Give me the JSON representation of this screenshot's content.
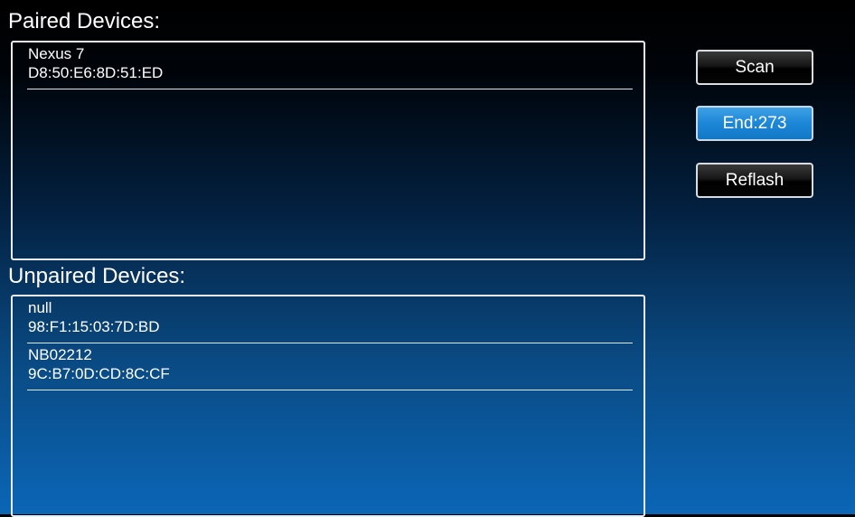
{
  "paired": {
    "title": "Paired Devices:",
    "devices": [
      {
        "name": "Nexus 7",
        "address": "D8:50:E6:8D:51:ED"
      }
    ]
  },
  "unpaired": {
    "title": "Unpaired Devices:",
    "devices": [
      {
        "name": "null",
        "address": "98:F1:15:03:7D:BD"
      },
      {
        "name": "NB02212",
        "address": "9C:B7:0D:CD:8C:CF"
      }
    ]
  },
  "buttons": {
    "scan": "Scan",
    "end": "End:273",
    "reflash": "Reflash"
  },
  "colors": {
    "accent_button": "#1c86d7",
    "background_top": "#000000",
    "background_bottom": "#0b66b6"
  }
}
